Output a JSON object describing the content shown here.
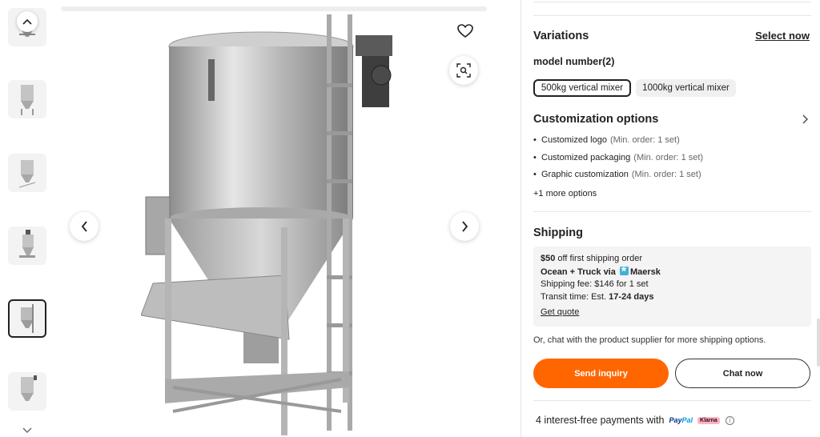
{
  "gallery": {
    "thumbnails": [
      {
        "alt": "mixer-thumb-1"
      },
      {
        "alt": "mixer-thumb-2"
      },
      {
        "alt": "mixer-thumb-3"
      },
      {
        "alt": "mixer-thumb-4"
      },
      {
        "alt": "mixer-thumb-5",
        "active": true
      },
      {
        "alt": "mixer-thumb-6"
      }
    ],
    "icons": {
      "thumb_up": "chevron-up-icon",
      "thumb_down": "chevron-down-icon",
      "prev": "chevron-left-icon",
      "next": "chevron-right-icon",
      "favorite": "heart-icon",
      "zoom": "image-search-icon"
    }
  },
  "variations": {
    "title": "Variations",
    "select_now": "Select now",
    "model_label": "model number(2)",
    "options": [
      {
        "label": "500kg vertical mixer",
        "selected": true
      },
      {
        "label": "1000kg vertical mixer",
        "selected": false
      }
    ]
  },
  "customization": {
    "title": "Customization options",
    "items": [
      {
        "label": "Customized logo",
        "min_order": "(Min. order: 1 set)"
      },
      {
        "label": "Customized packaging",
        "min_order": "(Min. order: 1 set)"
      },
      {
        "label": "Graphic customization",
        "min_order": "(Min. order: 1 set)"
      }
    ],
    "more": "+1 more options"
  },
  "shipping": {
    "title": "Shipping",
    "promo_amount": "$50",
    "promo_text": "off first shipping order",
    "method_prefix": "Ocean + Truck via",
    "carrier": "Maersk",
    "fee": "Shipping fee: $146 for 1 set",
    "transit_prefix": "Transit time: Est.",
    "transit_days": "17-24 days",
    "get_quote": "Get quote",
    "chat_note": "Or, chat with the product supplier for more shipping options."
  },
  "actions": {
    "send_inquiry": "Send inquiry",
    "chat_now": "Chat now"
  },
  "payments": {
    "text": "4 interest-free payments with",
    "paypal_a": "Pay",
    "paypal_b": "Pal",
    "klarna": "Klarna"
  },
  "colors": {
    "accent": "#ff6600",
    "promo": "#e64b00"
  }
}
